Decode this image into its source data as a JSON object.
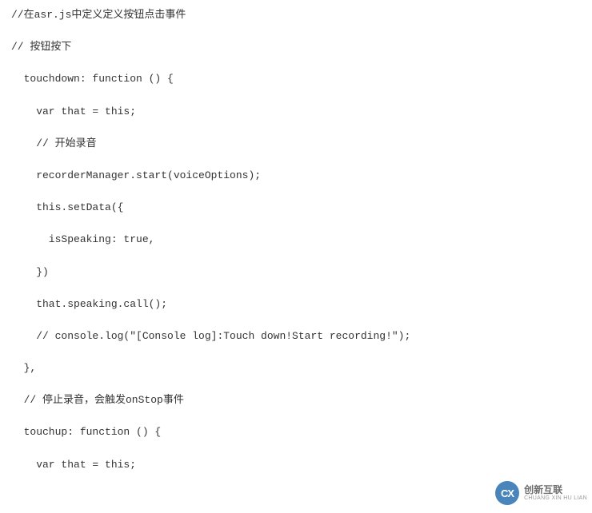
{
  "code": {
    "lines": [
      "//在asr.js中定义定义按钮点击事件",
      "",
      "// 按钮按下",
      "",
      "  touchdown: function () {",
      "",
      "    var that = this;",
      "",
      "    // 开始录音",
      "",
      "    recorderManager.start(voiceOptions);",
      "",
      "    this.setData({",
      "",
      "      isSpeaking: true,",
      "",
      "    })",
      "",
      "    that.speaking.call();",
      "",
      "    // console.log(\"[Console log]:Touch down!Start recording!\");",
      "",
      "  },",
      "",
      "  // 停止录音，会触发onStop事件",
      "",
      "  touchup: function () {",
      "",
      "    var that = this;"
    ]
  },
  "watermark": {
    "badge": "CX",
    "cn": "创新互联",
    "en": "CHUANG XIN HU LIAN"
  }
}
